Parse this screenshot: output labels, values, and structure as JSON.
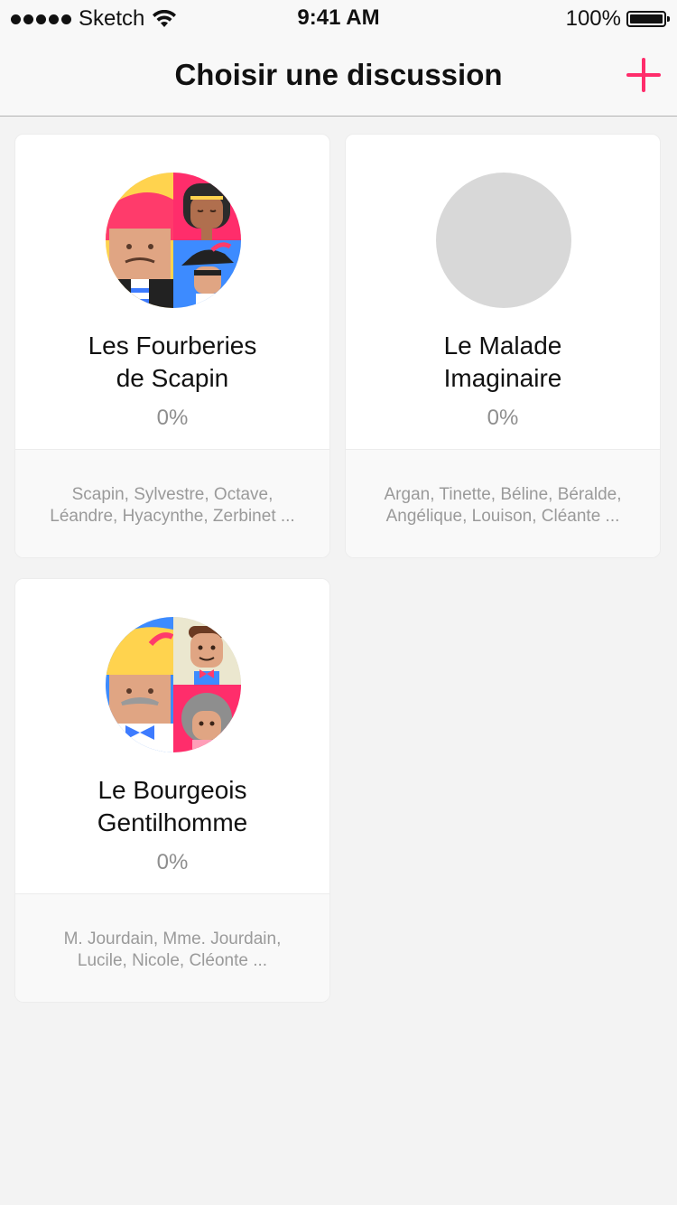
{
  "status_bar": {
    "carrier": "Sketch",
    "time": "9:41 AM",
    "battery": "100%"
  },
  "nav": {
    "title": "Choisir une discussion",
    "add_icon": "plus-icon",
    "accent_color": "#ff2d6b"
  },
  "discussions": [
    {
      "title_line1": "Les Fourberies",
      "title_line2": "de Scapin",
      "progress": "0%",
      "characters_line1": "Scapin, Sylvestre, Octave,",
      "characters_line2": "Léandre, Hyacynthe, Zerbinet ...",
      "avatar": "group-avatar-illustration"
    },
    {
      "title_line1": "Le Malade",
      "title_line2": "Imaginaire",
      "progress": "0%",
      "characters_line1": "Argan, Tinette, Béline, Béralde,",
      "characters_line2": "Angélique, Louison, Cléante ...",
      "avatar": "placeholder-avatar"
    },
    {
      "title_line1": "Le Bourgeois",
      "title_line2": "Gentilhomme",
      "progress": "0%",
      "characters_line1": "M. Jourdain, Mme. Jourdain,",
      "characters_line2": "Lucile, Nicole, Cléonte ...",
      "avatar": "group-avatar-illustration"
    }
  ]
}
